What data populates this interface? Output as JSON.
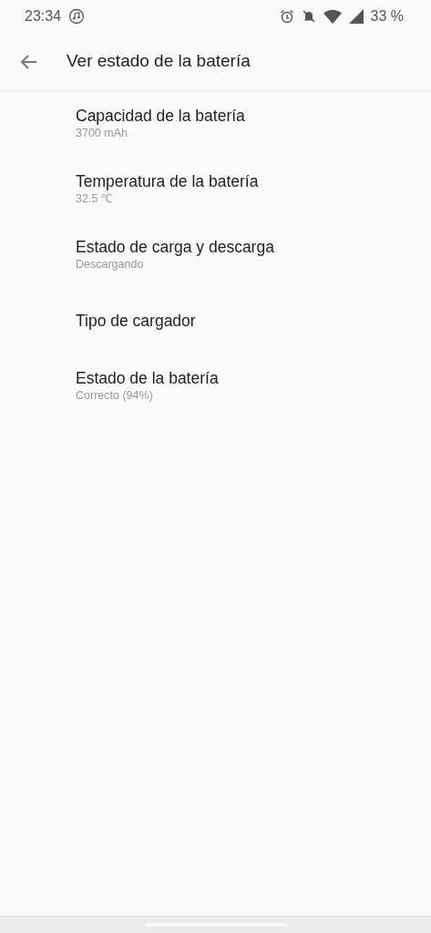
{
  "status_bar": {
    "time": "23:34",
    "battery": "33 %"
  },
  "app_bar": {
    "title": "Ver estado de la batería"
  },
  "items": [
    {
      "title": "Capacidad de la batería",
      "summary": "3700 mAh"
    },
    {
      "title": "Temperatura de la batería",
      "summary": "32.5 ℃"
    },
    {
      "title": "Estado de carga y descarga",
      "summary": "Descargando"
    },
    {
      "title": "Tipo de cargador"
    },
    {
      "title": "Estado de la batería",
      "summary": "Correcto (94%)"
    }
  ]
}
